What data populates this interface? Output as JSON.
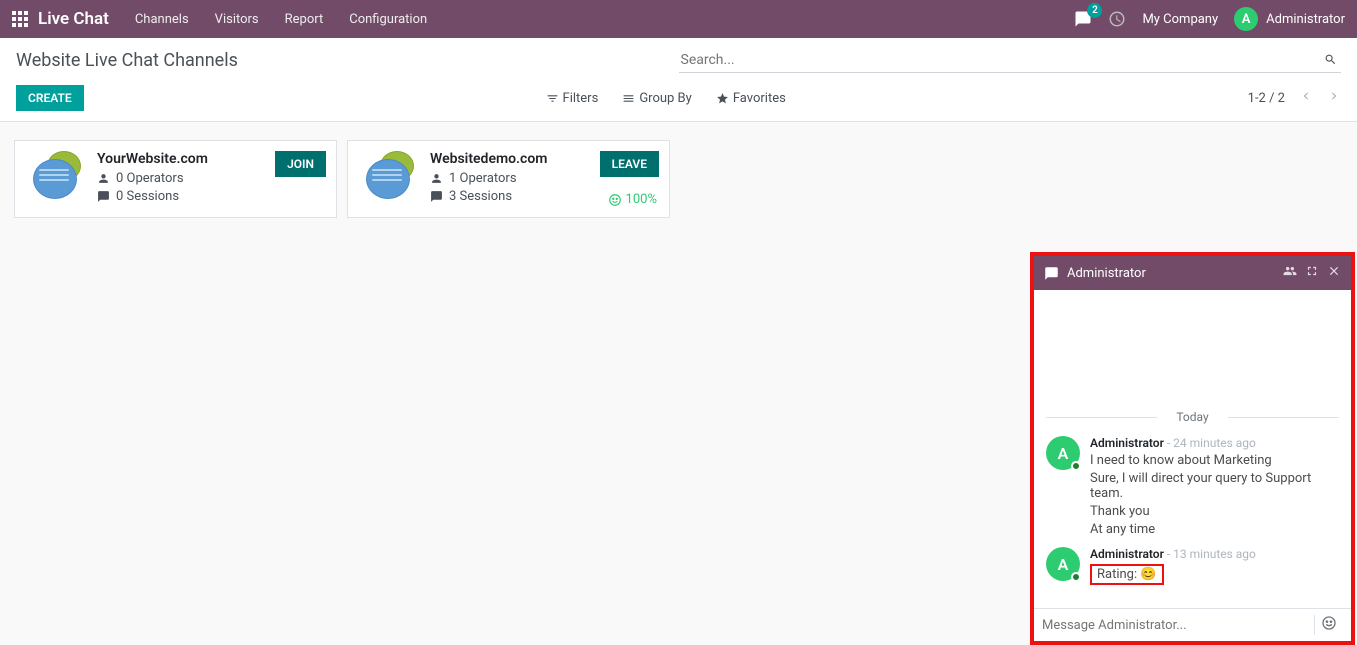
{
  "nav": {
    "brand": "Live Chat",
    "links": [
      "Channels",
      "Visitors",
      "Report",
      "Configuration"
    ],
    "msg_badge": "2",
    "company": "My Company",
    "user_initial": "A",
    "username": "Administrator"
  },
  "cp": {
    "title": "Website Live Chat Channels",
    "search_placeholder": "Search...",
    "create": "CREATE",
    "filters": "Filters",
    "groupby": "Group By",
    "favorites": "Favorites",
    "pager": "1-2 / 2"
  },
  "cards": [
    {
      "title": "YourWebsite.com",
      "operators": "0 Operators",
      "sessions": "0 Sessions",
      "action": "JOIN",
      "rating": ""
    },
    {
      "title": "Websitedemo.com",
      "operators": "1 Operators",
      "sessions": "3 Sessions",
      "action": "LEAVE",
      "rating": "100%"
    }
  ],
  "chat": {
    "title": "Administrator",
    "date": "Today",
    "groups": [
      {
        "initial": "A",
        "who": "Administrator",
        "when": "- 24 minutes ago",
        "lines": [
          "I need to know about Marketing",
          "Sure, I will direct your query to Support team.",
          "Thank you",
          "At any time"
        ]
      },
      {
        "initial": "A",
        "who": "Administrator",
        "when": "- 13 minutes ago",
        "rating_label": "Rating:",
        "rating_emoji": "😊"
      }
    ],
    "input_placeholder": "Message Administrator..."
  }
}
